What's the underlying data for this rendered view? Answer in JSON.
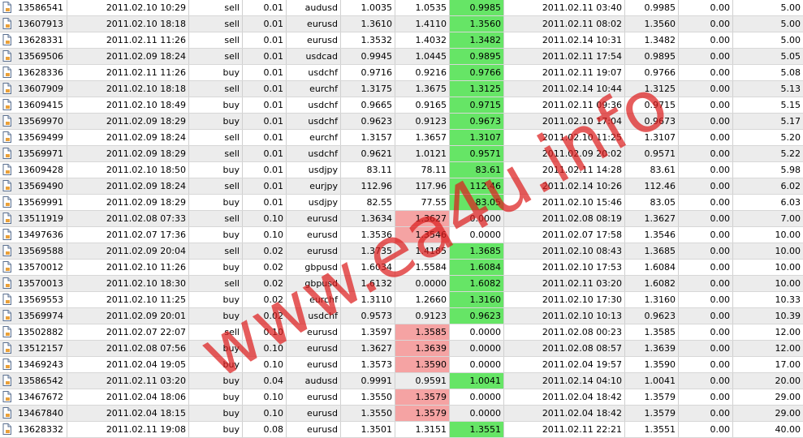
{
  "watermark": "www.ea4u.info",
  "colors": {
    "profit_highlight": "#66e566",
    "loss_highlight": "#f5a3a3",
    "alt_row": "#ececec"
  },
  "icon": "document-icon",
  "rows": [
    [
      "13586541",
      "2011.02.10 10:29",
      "sell",
      "0.01",
      "audusd",
      "1.0035",
      "1.0535",
      "0.9985",
      "2011.02.11 03:40",
      "0.9985",
      "0.00",
      "5.00",
      "green"
    ],
    [
      "13607913",
      "2011.02.10 18:18",
      "sell",
      "0.01",
      "eurusd",
      "1.3610",
      "1.4110",
      "1.3560",
      "2011.02.11 08:02",
      "1.3560",
      "0.00",
      "5.00",
      "green"
    ],
    [
      "13628331",
      "2011.02.11 11:26",
      "sell",
      "0.01",
      "eurusd",
      "1.3532",
      "1.4032",
      "1.3482",
      "2011.02.14 10:31",
      "1.3482",
      "0.00",
      "5.00",
      "green"
    ],
    [
      "13569506",
      "2011.02.09 18:24",
      "sell",
      "0.01",
      "usdcad",
      "0.9945",
      "1.0445",
      "0.9895",
      "2011.02.11 17:54",
      "0.9895",
      "0.00",
      "5.05",
      "green"
    ],
    [
      "13628336",
      "2011.02.11 11:26",
      "buy",
      "0.01",
      "usdchf",
      "0.9716",
      "0.9216",
      "0.9766",
      "2011.02.11 19:07",
      "0.9766",
      "0.00",
      "5.08",
      "green"
    ],
    [
      "13607909",
      "2011.02.10 18:18",
      "sell",
      "0.01",
      "eurchf",
      "1.3175",
      "1.3675",
      "1.3125",
      "2011.02.14 10:44",
      "1.3125",
      "0.00",
      "5.13",
      "green"
    ],
    [
      "13609415",
      "2011.02.10 18:49",
      "buy",
      "0.01",
      "usdchf",
      "0.9665",
      "0.9165",
      "0.9715",
      "2011.02.11 09:36",
      "0.9715",
      "0.00",
      "5.15",
      "green"
    ],
    [
      "13569970",
      "2011.02.09 18:29",
      "buy",
      "0.01",
      "usdchf",
      "0.9623",
      "0.9123",
      "0.9673",
      "2011.02.10 17:04",
      "0.9673",
      "0.00",
      "5.17",
      "green"
    ],
    [
      "13569499",
      "2011.02.09 18:24",
      "sell",
      "0.01",
      "eurchf",
      "1.3157",
      "1.3657",
      "1.3107",
      "2011.02.10 11:25",
      "1.3107",
      "0.00",
      "5.20",
      "green"
    ],
    [
      "13569971",
      "2011.02.09 18:29",
      "sell",
      "0.01",
      "usdchf",
      "0.9621",
      "1.0121",
      "0.9571",
      "2011.02.09 20:02",
      "0.9571",
      "0.00",
      "5.22",
      "green"
    ],
    [
      "13609428",
      "2011.02.10 18:50",
      "buy",
      "0.01",
      "usdjpy",
      "83.11",
      "78.11",
      "83.61",
      "2011.02.11 14:28",
      "83.61",
      "0.00",
      "5.98",
      "green"
    ],
    [
      "13569490",
      "2011.02.09 18:24",
      "sell",
      "0.01",
      "eurjpy",
      "112.96",
      "117.96",
      "112.46",
      "2011.02.14 10:26",
      "112.46",
      "0.00",
      "6.02",
      "green"
    ],
    [
      "13569991",
      "2011.02.09 18:29",
      "buy",
      "0.01",
      "usdjpy",
      "82.55",
      "77.55",
      "83.05",
      "2011.02.10 15:46",
      "83.05",
      "0.00",
      "6.03",
      "green"
    ],
    [
      "13511919",
      "2011.02.08 07:33",
      "sell",
      "0.10",
      "eurusd",
      "1.3634",
      "1.3627",
      "0.0000",
      "2011.02.08 08:19",
      "1.3627",
      "0.00",
      "7.00",
      "red"
    ],
    [
      "13497636",
      "2011.02.07 17:36",
      "buy",
      "0.10",
      "eurusd",
      "1.3536",
      "1.3546",
      "0.0000",
      "2011.02.07 17:58",
      "1.3546",
      "0.00",
      "10.00",
      "red"
    ],
    [
      "13569588",
      "2011.02.09 20:04",
      "sell",
      "0.02",
      "eurusd",
      "1.3735",
      "1.4185",
      "1.3685",
      "2011.02.10 08:43",
      "1.3685",
      "0.00",
      "10.00",
      "green"
    ],
    [
      "13570012",
      "2011.02.10 11:26",
      "buy",
      "0.02",
      "gbpusd",
      "1.6034",
      "1.5584",
      "1.6084",
      "2011.02.10 17:53",
      "1.6084",
      "0.00",
      "10.00",
      "green"
    ],
    [
      "13570013",
      "2011.02.10 18:30",
      "sell",
      "0.02",
      "gbpusd",
      "1.6132",
      "0.0000",
      "1.6082",
      "2011.02.11 03:20",
      "1.6082",
      "0.00",
      "10.00",
      "green"
    ],
    [
      "13569553",
      "2011.02.10 11:25",
      "buy",
      "0.02",
      "eurchf",
      "1.3110",
      "1.2660",
      "1.3160",
      "2011.02.10 17:30",
      "1.3160",
      "0.00",
      "10.33",
      "green"
    ],
    [
      "13569974",
      "2011.02.09 20:01",
      "buy",
      "0.02",
      "usdchf",
      "0.9573",
      "0.9123",
      "0.9623",
      "2011.02.10 10:13",
      "0.9623",
      "0.00",
      "10.39",
      "green"
    ],
    [
      "13502882",
      "2011.02.07 22:07",
      "sell",
      "0.10",
      "eurusd",
      "1.3597",
      "1.3585",
      "0.0000",
      "2011.02.08 00:23",
      "1.3585",
      "0.00",
      "12.00",
      "red"
    ],
    [
      "13512157",
      "2011.02.08 07:56",
      "buy",
      "0.10",
      "eurusd",
      "1.3627",
      "1.3639",
      "0.0000",
      "2011.02.08 08:57",
      "1.3639",
      "0.00",
      "12.00",
      "red"
    ],
    [
      "13469243",
      "2011.02.04 19:05",
      "buy",
      "0.10",
      "eurusd",
      "1.3573",
      "1.3590",
      "0.0000",
      "2011.02.04 19:57",
      "1.3590",
      "0.00",
      "17.00",
      "red"
    ],
    [
      "13586542",
      "2011.02.11 03:20",
      "buy",
      "0.04",
      "audusd",
      "0.9991",
      "0.9591",
      "1.0041",
      "2011.02.14 04:10",
      "1.0041",
      "0.00",
      "20.00",
      "green"
    ],
    [
      "13467672",
      "2011.02.04 18:06",
      "buy",
      "0.10",
      "eurusd",
      "1.3550",
      "1.3579",
      "0.0000",
      "2011.02.04 18:42",
      "1.3579",
      "0.00",
      "29.00",
      "red"
    ],
    [
      "13467840",
      "2011.02.04 18:15",
      "buy",
      "0.10",
      "eurusd",
      "1.3550",
      "1.3579",
      "0.0000",
      "2011.02.04 18:42",
      "1.3579",
      "0.00",
      "29.00",
      "red"
    ],
    [
      "13628332",
      "2011.02.11 19:08",
      "buy",
      "0.08",
      "eurusd",
      "1.3501",
      "1.3151",
      "1.3551",
      "2011.02.11 22:21",
      "1.3551",
      "0.00",
      "40.00",
      "green"
    ]
  ]
}
